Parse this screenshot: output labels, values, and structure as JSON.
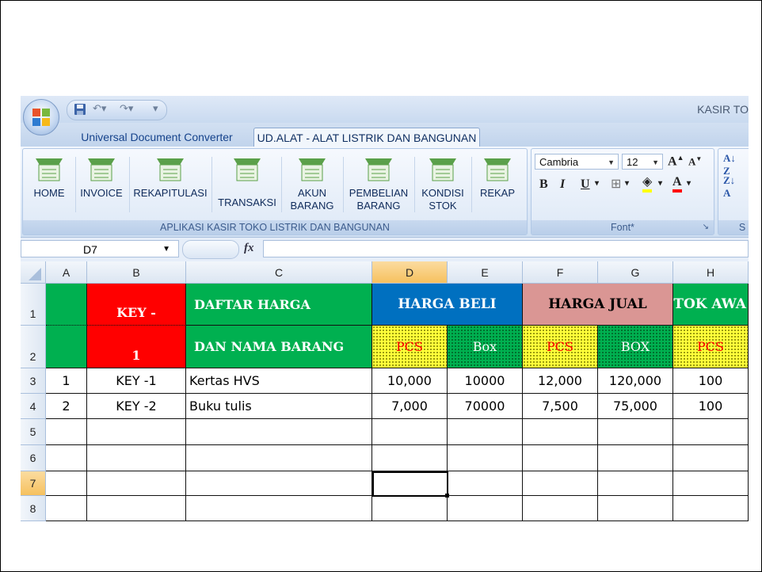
{
  "window": {
    "title": "KASIR TO"
  },
  "tabs": [
    {
      "label": "Universal Document Converter",
      "active": false
    },
    {
      "label": "UD.ALAT - ALAT LISTRIK DAN BANGUNAN",
      "active": true
    }
  ],
  "ribbon": {
    "buttons": [
      {
        "line1": "HOME",
        "line2": ""
      },
      {
        "line1": "INVOICE",
        "line2": ""
      },
      {
        "line1": "REKAPITULASI",
        "line2": ""
      },
      {
        "line1": "TRANSAKSI",
        "line2": ""
      },
      {
        "line1": "AKUN",
        "line2": "BARANG"
      },
      {
        "line1": "PEMBELIAN",
        "line2": "BARANG"
      },
      {
        "line1": "KONDISI",
        "line2": "STOK"
      },
      {
        "line1": "REKAP",
        "line2": ""
      }
    ],
    "group_label": "APLIKASI  KASIR TOKO LISTRIK DAN BANGUNAN",
    "font_group_label": "Font*",
    "font_name": "Cambria",
    "font_size": "12",
    "extra_group_label": "S"
  },
  "formula_bar": {
    "name_box": "D7",
    "fx_label": "fx",
    "value": ""
  },
  "columns": [
    "A",
    "B",
    "C",
    "D",
    "E",
    "F",
    "G",
    "H"
  ],
  "selected_column": "D",
  "rows": [
    "1",
    "2",
    "3",
    "4",
    "5",
    "6",
    "7",
    "8"
  ],
  "selected_row": "7",
  "header_cells": {
    "key_top": "KEY -",
    "key_bottom": "1",
    "daftar_harga": "DAFTAR HARGA",
    "dan_nama_barang": "DAN NAMA BARANG",
    "harga_beli": "HARGA BELI",
    "harga_jual": "HARGA JUAL",
    "stok_awal": "STOK AWA",
    "pcs_d": "PCS",
    "box_e": "Box",
    "pcs_f": "PCS",
    "box_g": "BOX",
    "pcs_h": "PCS"
  },
  "data_rows": [
    {
      "no": "1",
      "key": "KEY -1",
      "nama": "Kertas HVS",
      "beli_pcs": "10,000",
      "beli_box": "10000",
      "jual_pcs": "12,000",
      "jual_box": "120,000",
      "stok": "100"
    },
    {
      "no": "2",
      "key": "KEY -2",
      "nama": "Buku tulis",
      "beli_pcs": "7,000",
      "beli_box": "70000",
      "jual_pcs": "7,500",
      "jual_box": "75,000",
      "stok": "100"
    }
  ],
  "colors": {
    "green": "#00b050",
    "red": "#ff0000",
    "blue": "#0070c0",
    "pink": "#da9694",
    "yellow": "#ffff00"
  }
}
